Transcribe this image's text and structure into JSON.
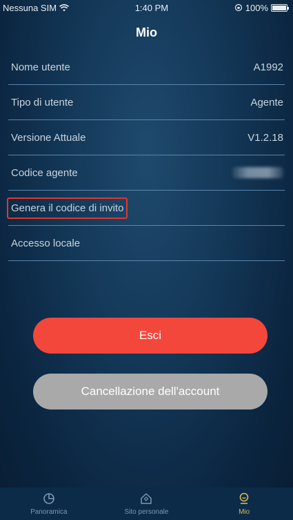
{
  "status_bar": {
    "carrier": "Nessuna SIM",
    "time": "1:40 PM",
    "battery": "100%"
  },
  "header": {
    "title": "Mio"
  },
  "settings": {
    "rows": [
      {
        "label": "Nome utente",
        "value": "A1992"
      },
      {
        "label": "Tipo di utente",
        "value": "Agente"
      },
      {
        "label": "Versione Attuale",
        "value": "V1.2.18"
      },
      {
        "label": "Codice agente",
        "value": ""
      },
      {
        "label": "Genera il codice di invito"
      },
      {
        "label": "Accesso locale"
      }
    ]
  },
  "actions": {
    "logout_label": "Esci",
    "delete_account_label": "Cancellazione dell'account"
  },
  "tab_bar": {
    "tabs": [
      {
        "label": "Panoramica",
        "icon": "pie-chart-icon"
      },
      {
        "label": "Sito personale",
        "icon": "home-icon"
      },
      {
        "label": "Mio",
        "icon": "user-icon"
      }
    ],
    "active_tab": "Mio"
  },
  "colors": {
    "primary_button": "#f4473c",
    "secondary_button": "#a9a9a9",
    "active_tab": "#e1b64c",
    "highlight_border": "#e0382e"
  }
}
